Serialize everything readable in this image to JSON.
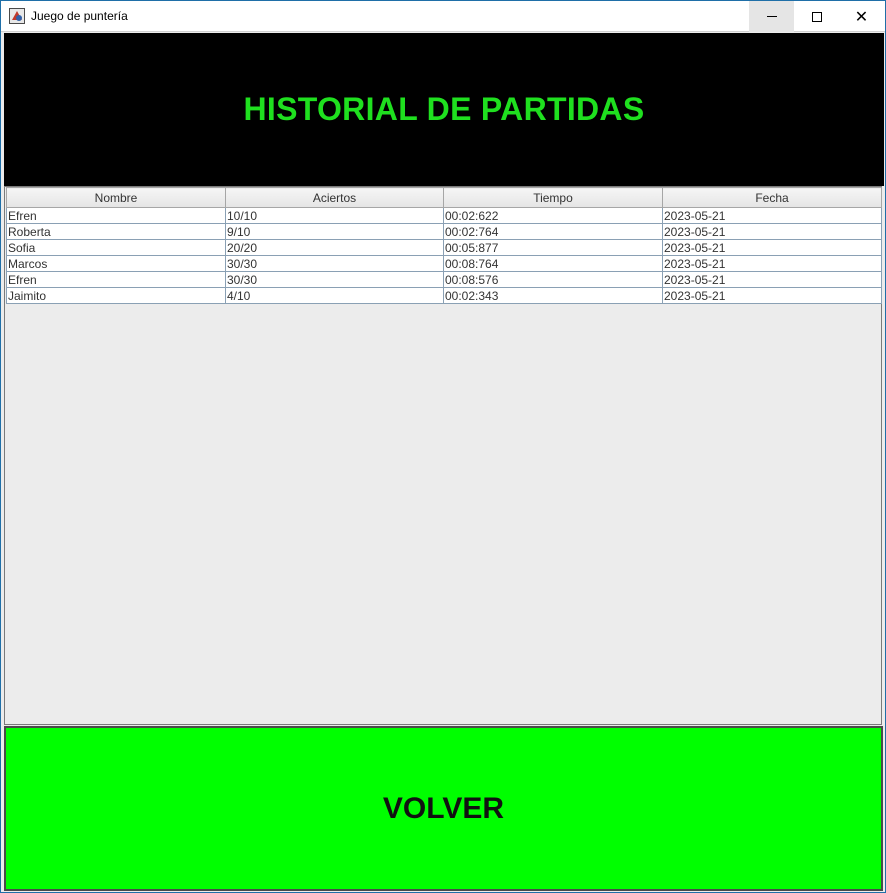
{
  "window": {
    "title": "Juego de puntería",
    "icon": "java-app-icon"
  },
  "header": {
    "title": "HISTORIAL DE PARTIDAS",
    "background": "#000000",
    "color": "#1fe01f"
  },
  "table": {
    "columns": [
      "Nombre",
      "Aciertos",
      "Tiempo",
      "Fecha"
    ],
    "rows": [
      [
        "Efren",
        "10/10",
        "00:02:622",
        "2023-05-21"
      ],
      [
        "Roberta",
        "9/10",
        "00:02:764",
        "2023-05-21"
      ],
      [
        "Sofia",
        "20/20",
        "00:05:877",
        "2023-05-21"
      ],
      [
        "Marcos",
        "30/30",
        "00:08:764",
        "2023-05-21"
      ],
      [
        "Efren",
        "30/30",
        "00:08:576",
        "2023-05-21"
      ],
      [
        "Jaimito",
        "4/10",
        "00:02:343",
        "2023-05-21"
      ]
    ]
  },
  "back_button": {
    "label": "VOLVER",
    "background": "#00ff00"
  }
}
